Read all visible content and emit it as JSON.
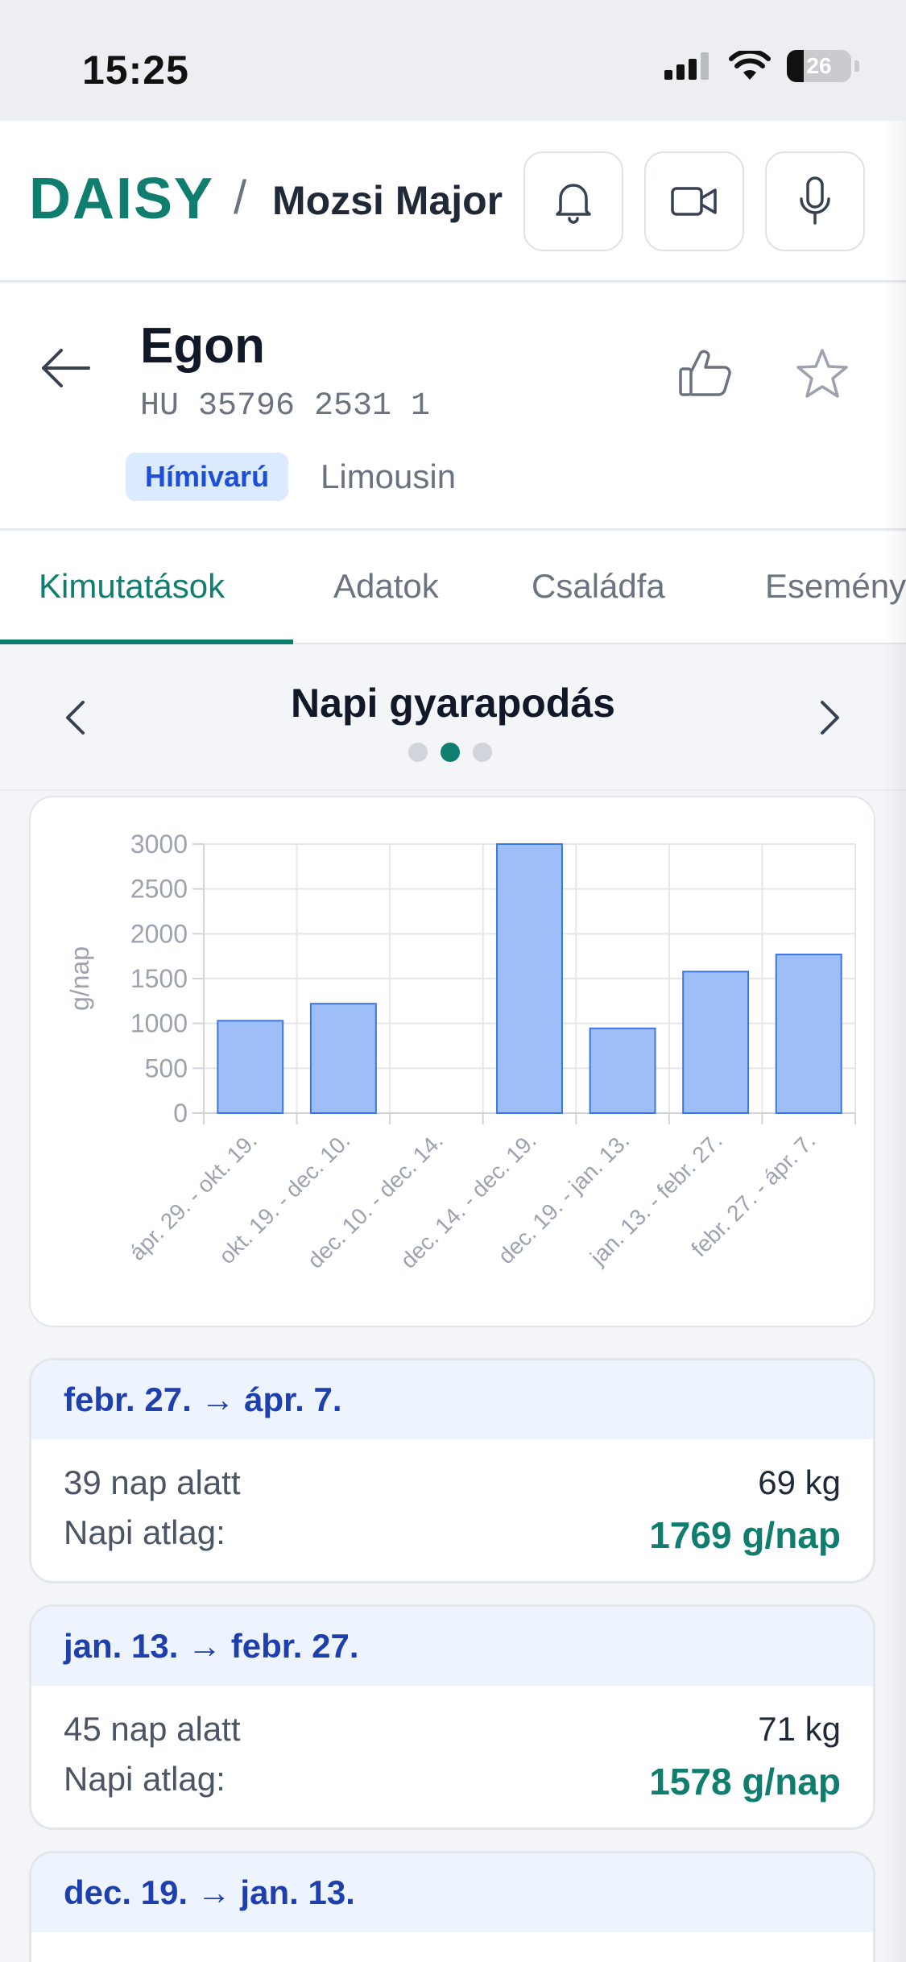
{
  "status_bar": {
    "time": "15:25",
    "battery": "26"
  },
  "header": {
    "brand": "DAISY",
    "separator": "/",
    "farm_name": "Mozsi Major"
  },
  "animal": {
    "name": "Egon",
    "id": "HU 35796 2531 1",
    "sex_badge": "Hímivarú",
    "breed": "Limousin"
  },
  "tabs": [
    "Kimutatások",
    "Adatok",
    "Családfa",
    "Esemény"
  ],
  "chart_nav": {
    "title": "Napi gyarapodás",
    "page_count": 3,
    "active_page": 1
  },
  "chart_data": {
    "type": "bar",
    "categories": [
      "ápr. 29. - okt. 19.",
      "okt. 19. - dec. 10.",
      "dec. 10. - dec. 14.",
      "dec. 14. - dec. 19.",
      "dec. 19. - jan. 13.",
      "jan. 13. - febr. 27.",
      "febr. 27. - ápr. 7."
    ],
    "values": [
      1030,
      1220,
      0,
      3000,
      945,
      1578,
      1769
    ],
    "ylabel": "g/nap",
    "yticks": [
      "0",
      "500",
      "1000",
      "1500",
      "2000",
      "2500",
      "3000"
    ],
    "ylim": [
      0,
      3000
    ],
    "grid": true,
    "bar_color": "#9dbef7",
    "bar_border_color": "#3b76e6"
  },
  "periods": [
    {
      "range": "febr. 27. → ápr. 7.",
      "days": "39 nap alatt",
      "weight": "69 kg",
      "avg_label": "Napi atlag:",
      "avg": "1769 g/nap"
    },
    {
      "range": "jan. 13. → febr. 27.",
      "days": "45 nap alatt",
      "weight": "71 kg",
      "avg_label": "Napi atlag:",
      "avg": "1578 g/nap"
    },
    {
      "range": "dec. 19. → jan. 13.",
      "days": "",
      "weight": "",
      "avg_label": "",
      "avg": ""
    }
  ],
  "colors": {
    "brand": "#0f7e6f",
    "badge_text": "#1d4ed8",
    "period_head": "#1e40af"
  }
}
